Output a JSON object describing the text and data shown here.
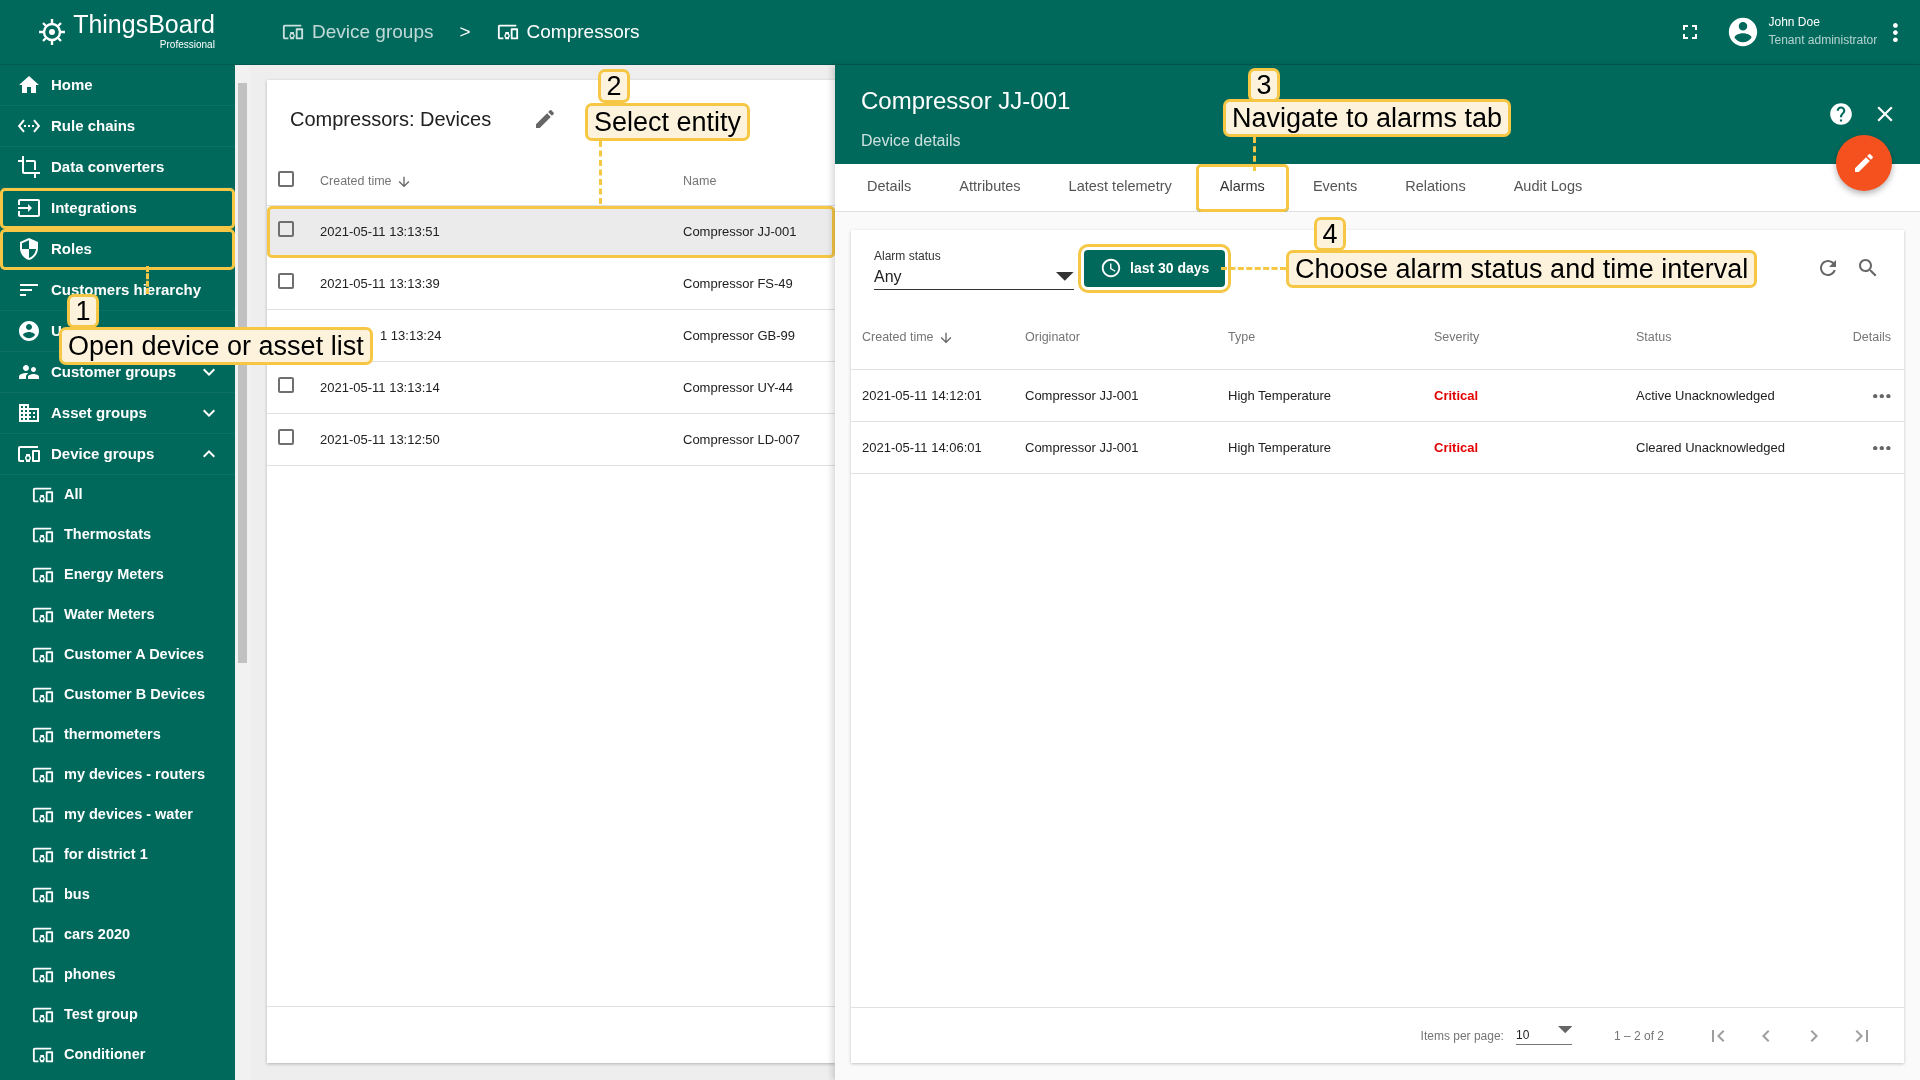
{
  "app": {
    "logo_title": "ThingsBoard",
    "logo_subtitle": "Professional"
  },
  "breadcrumb": {
    "items": [
      "Device groups",
      "Compressors"
    ],
    "separator": ">"
  },
  "user": {
    "name": "John Doe",
    "role": "Tenant administrator"
  },
  "sidebar": {
    "items": [
      {
        "kind": "home",
        "label": "Home",
        "highlighted": false
      },
      {
        "kind": "rule-chains",
        "label": "Rule chains",
        "highlighted": false
      },
      {
        "kind": "converters",
        "label": "Data converters",
        "highlighted": false
      },
      {
        "kind": "integrations",
        "label": "Integrations",
        "highlighted": true
      },
      {
        "kind": "roles",
        "label": "Roles",
        "highlighted": true
      },
      {
        "kind": "hierarchy",
        "label": "Customers hierarchy",
        "highlighted": false
      },
      {
        "kind": "users",
        "label": "U",
        "highlighted": false
      },
      {
        "kind": "customer-groups",
        "label": "Customer groups",
        "highlighted": false,
        "expanded": false
      },
      {
        "kind": "asset-groups",
        "label": "Asset groups",
        "highlighted": false,
        "expanded": false
      },
      {
        "kind": "device-groups",
        "label": "Device groups",
        "highlighted": false,
        "expanded": true,
        "children": [
          "All",
          "Thermostats",
          "Energy Meters",
          "Water Meters",
          "Customer A Devices",
          "Customer B Devices",
          "thermometers",
          "my devices - routers",
          "my devices - water",
          "for district 1",
          "bus",
          "cars 2020",
          "phones",
          "Test group",
          "Conditioner"
        ]
      }
    ]
  },
  "devices_card": {
    "title": "Compressors: Devices",
    "all_checked": false,
    "columns": [
      "Created time",
      "Name"
    ],
    "rows": [
      {
        "created_time": "2021-05-11 13:13:51",
        "name": "Compressor JJ-001",
        "checked": false,
        "selected": true,
        "highlighted": true
      },
      {
        "created_time": "2021-05-11 13:13:39",
        "name": "Compressor FS-49",
        "checked": false,
        "selected": false,
        "highlighted": false
      },
      {
        "created_time": "1 13:13:24",
        "name": "Compressor GB-99",
        "selected": false,
        "highlighted": false,
        "partly_hidden": true
      },
      {
        "created_time": "2021-05-11 13:13:14",
        "name": "Compressor UY-44",
        "checked": false,
        "selected": false,
        "highlighted": false
      },
      {
        "created_time": "2021-05-11 13:12:50",
        "name": "Compressor LD-007",
        "checked": false,
        "selected": false,
        "highlighted": false
      }
    ]
  },
  "details": {
    "title": "Compressor JJ-001",
    "subtitle": "Device details",
    "tabs": [
      {
        "label": "Details",
        "selected": false,
        "highlighted": false
      },
      {
        "label": "Attributes",
        "selected": false,
        "highlighted": false
      },
      {
        "label": "Latest telemetry",
        "selected": false,
        "highlighted": false
      },
      {
        "label": "Alarms",
        "selected": true,
        "highlighted": true
      },
      {
        "label": "Events",
        "selected": false,
        "highlighted": false
      },
      {
        "label": "Relations",
        "selected": false,
        "highlighted": false
      },
      {
        "label": "Audit Logs",
        "selected": false,
        "highlighted": false
      }
    ],
    "alarm_filter": {
      "label": "Alarm status",
      "value": "Any"
    },
    "time_button": {
      "label": "last 30 days",
      "highlighted": true
    },
    "alarms": {
      "columns": [
        "Created time",
        "Originator",
        "Type",
        "Severity",
        "Status",
        "Details"
      ],
      "rows": [
        {
          "created_time": "2021-05-11 14:12:01",
          "originator": "Compressor JJ-001",
          "type": "High Temperature",
          "severity": "Critical",
          "status": "Active Unacknowledged"
        },
        {
          "created_time": "2021-05-11 14:06:01",
          "originator": "Compressor JJ-001",
          "type": "High Temperature",
          "severity": "Critical",
          "status": "Cleared Unacknowledged"
        }
      ]
    },
    "paginator": {
      "items_per_page_label": "Items per page:",
      "items_per_page": "10",
      "range": "1 – 2 of 2"
    }
  },
  "callouts": [
    {
      "number": "1",
      "text": "Open device or asset list"
    },
    {
      "number": "2",
      "text": "Select entity"
    },
    {
      "number": "3",
      "text": "Navigate to alarms tab"
    },
    {
      "number": "4",
      "text": "Choose alarm status and time interval"
    }
  ]
}
